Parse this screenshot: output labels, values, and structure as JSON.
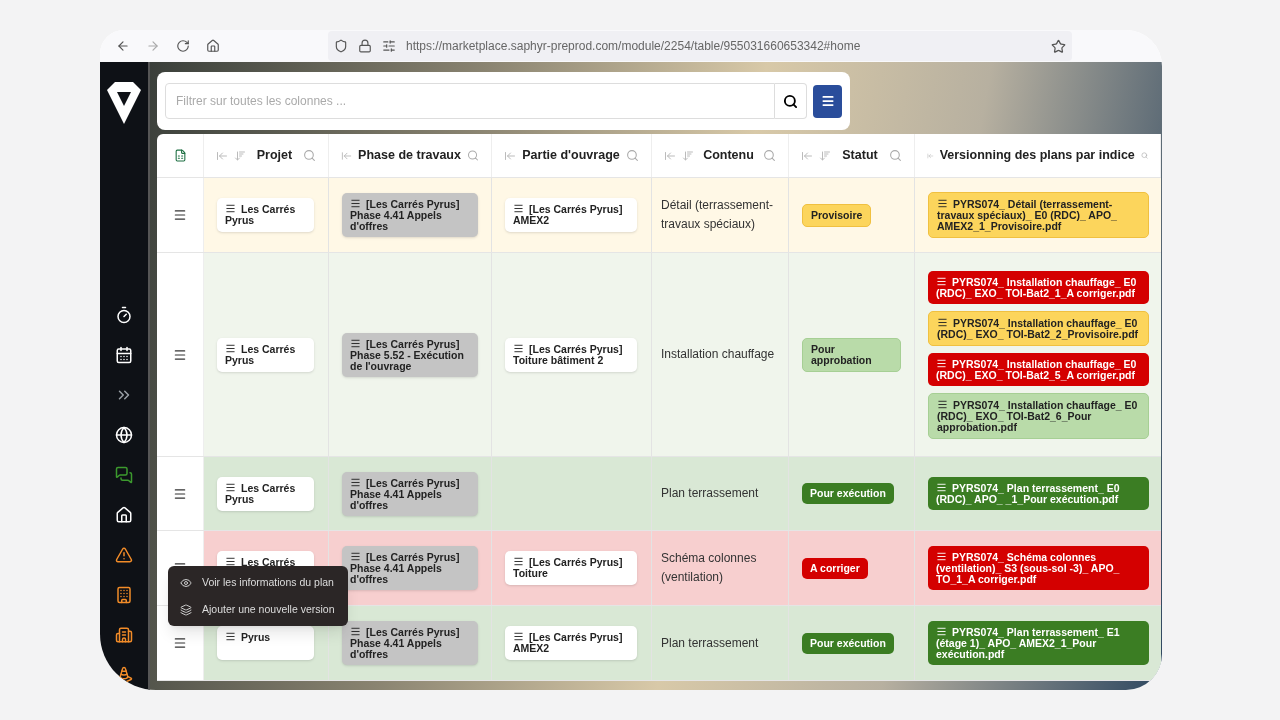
{
  "browser": {
    "url": "https://marketplace.saphyr-preprod.com/module/2254/table/955031660653342#home"
  },
  "search": {
    "placeholder": "Filtrer sur toutes les colonnes ..."
  },
  "columns": [
    {
      "title": "Projet",
      "sortable": true
    },
    {
      "title": "Phase de travaux",
      "sortable": false
    },
    {
      "title": "Partie d'ouvrage",
      "sortable": false
    },
    {
      "title": "Contenu",
      "sortable": true
    },
    {
      "title": "Statut",
      "sortable": true
    },
    {
      "title": "Versionning des plans par indice",
      "sortable": false
    }
  ],
  "rows": [
    {
      "color": "#fff8e6",
      "project": "Les Carrés Pyrus",
      "phase": "[Les Carrés Pyrus] Phase 4.41 Appels d'offres",
      "partie": "[Les Carrés Pyrus] AMEX2",
      "contenu": "Détail (terrassement-travaux spéciaux)",
      "statut": {
        "label": "Provisoire",
        "kind": "provisoire"
      },
      "files": [
        {
          "name": "PYRS074_ Détail (terrassement-travaux spéciaux)_ E0 (RDC)_ APO_ AMEX2_1_Provisoire.pdf",
          "kind": "provisoire"
        }
      ]
    },
    {
      "color": "#f0f5ec",
      "project": "Les Carrés Pyrus",
      "phase": "[Les Carrés Pyrus] Phase 5.52 - Exécution de l'ouvrage",
      "partie": "[Les Carrés Pyrus] Toiture bâtiment 2",
      "contenu": "Installation chauffage",
      "statut": {
        "label": "Pour approbation",
        "kind": "approbation"
      },
      "files": [
        {
          "name": "PYRS074_ Installation chauffage_ E0 (RDC)_ EXO_ TOI-Bat2_1_A corriger.pdf",
          "kind": "corriger"
        },
        {
          "name": "PYRS074_ Installation chauffage_ E0 (RDC)_ EXO_ TOI-Bat2_2_Provisoire.pdf",
          "kind": "provisoire"
        },
        {
          "name": "PYRS074_ Installation chauffage_ E0 (RDC)_ EXO_ TOI-Bat2_5_A corriger.pdf",
          "kind": "corriger"
        },
        {
          "name": "PYRS074_ Installation chauffage_ E0 (RDC)_ EXO_ TOI-Bat2_6_Pour approbation.pdf",
          "kind": "approbation"
        }
      ]
    },
    {
      "color": "#d9e8d5",
      "project": "Les Carrés Pyrus",
      "phase": "[Les Carrés Pyrus] Phase 4.41 Appels d'offres",
      "contenu": "Plan terrassement",
      "statut": {
        "label": "Pour exécution",
        "kind": "execution"
      },
      "files": [
        {
          "name": "PYRS074_ Plan terrassement_ E0 (RDC)_ APO_ _1_Pour exécution.pdf",
          "kind": "execution"
        }
      ]
    },
    {
      "color": "#f7cfcf",
      "project": "Les Carrés",
      "phase": "[Les Carrés Pyrus] Phase 4.41 Appels d'offres",
      "partie": "[Les Carrés Pyrus] Toiture",
      "contenu": "Schéma colonnes (ventilation)",
      "statut": {
        "label": "A corriger",
        "kind": "corriger"
      },
      "files": [
        {
          "name": "PYRS074_ Schéma colonnes (ventilation)_ S3 (sous-sol -3)_ APO_ TO_1_A corriger.pdf",
          "kind": "corriger"
        }
      ]
    },
    {
      "color": "#d9e8d5",
      "project": "Pyrus",
      "phase": "[Les Carrés Pyrus] Phase 4.41 Appels d'offres",
      "partie": "[Les Carrés Pyrus] AMEX2",
      "contenu": "Plan terrassement",
      "statut": {
        "label": "Pour exécution",
        "kind": "execution"
      },
      "files": [
        {
          "name": "PYRS074_ Plan terrassement_ E1 (étage 1)_ APO_ AMEX2_1_Pour exécution.pdf",
          "kind": "execution"
        }
      ]
    }
  ],
  "context_menu": [
    {
      "label": "Voir les informations du plan",
      "kind": "view"
    },
    {
      "label": "Ajouter une nouvelle version",
      "kind": "add"
    }
  ]
}
